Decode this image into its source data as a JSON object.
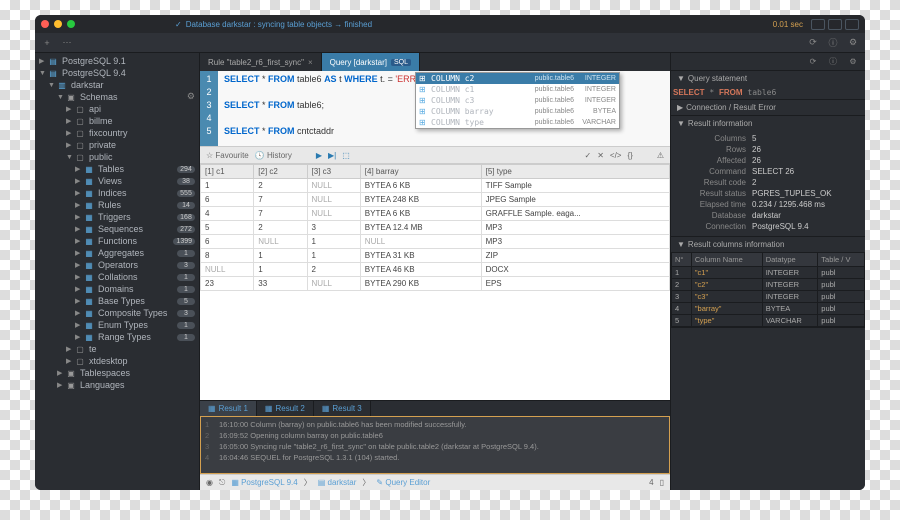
{
  "titlebar": {
    "status_text": "Database darkstar : syncing table objects → finished",
    "timing": "0.01 sec"
  },
  "sidebar": {
    "servers": [
      {
        "name": "PostgreSQL 9.1",
        "expanded": false
      },
      {
        "name": "PostgreSQL 9.4",
        "expanded": true,
        "databases": [
          {
            "name": "darkstar",
            "expanded": true,
            "schemas_label": "Schemas",
            "schemas": [
              {
                "name": "api"
              },
              {
                "name": "billme"
              },
              {
                "name": "fixcountry"
              },
              {
                "name": "private"
              },
              {
                "name": "public",
                "expanded": true,
                "items": [
                  {
                    "name": "Tables",
                    "count": 294
                  },
                  {
                    "name": "Views",
                    "count": 38
                  },
                  {
                    "name": "Indices",
                    "count": 555
                  },
                  {
                    "name": "Rules",
                    "count": 14
                  },
                  {
                    "name": "Triggers",
                    "count": 168
                  },
                  {
                    "name": "Sequences",
                    "count": 272
                  },
                  {
                    "name": "Functions",
                    "count": 1399
                  },
                  {
                    "name": "Aggregates",
                    "count": 1
                  },
                  {
                    "name": "Operators",
                    "count": 3
                  },
                  {
                    "name": "Collations",
                    "count": 1
                  },
                  {
                    "name": "Domains",
                    "count": 1
                  },
                  {
                    "name": "Base Types",
                    "count": 5
                  },
                  {
                    "name": "Composite Types",
                    "count": 3
                  },
                  {
                    "name": "Enum Types",
                    "count": 1
                  },
                  {
                    "name": "Range Types",
                    "count": 1
                  }
                ]
              },
              {
                "name": "te"
              },
              {
                "name": "xtdesktop"
              }
            ],
            "extras": [
              {
                "name": "Tablespaces"
              },
              {
                "name": "Languages"
              }
            ]
          }
        ]
      }
    ]
  },
  "tabs": [
    {
      "label": "Rule \"table2_r6_first_sync\"",
      "active": false
    },
    {
      "label": "Query [darkstar]",
      "active": true,
      "badge": "SQL"
    }
  ],
  "editor": {
    "lines": [
      {
        "n": 1,
        "sql": "SELECT * FROM table6 AS t WHERE t. = 'ERROR';"
      },
      {
        "n": 2,
        "sql": ""
      },
      {
        "n": 3,
        "sql": "SELECT * FROM table6;"
      },
      {
        "n": 4,
        "sql": ""
      },
      {
        "n": 5,
        "sql": "SELECT * FROM cntctaddr"
      }
    ]
  },
  "autocomplete": [
    {
      "kind": "COLUMN",
      "name": "c2",
      "src": "public.table6",
      "type": "INTEGER",
      "sel": true
    },
    {
      "kind": "COLUMN",
      "name": "c1",
      "src": "public.table6",
      "type": "INTEGER"
    },
    {
      "kind": "COLUMN",
      "name": "c3",
      "src": "public.table6",
      "type": "INTEGER"
    },
    {
      "kind": "COLUMN",
      "name": "barray",
      "src": "public.table6",
      "type": "BYTEA"
    },
    {
      "kind": "COLUMN",
      "name": "type",
      "src": "public.table6",
      "type": "VARCHAR"
    }
  ],
  "editor_toolbar": {
    "fav": "Favourite",
    "hist": "History"
  },
  "grid": {
    "cols": [
      "[1] c1",
      "[2] c2",
      "[3] c3",
      "[4] barray",
      "[5] type"
    ],
    "rows": [
      [
        "1",
        "2",
        "NULL",
        "BYTEA 6 KB",
        "TIFF Sample"
      ],
      [
        "6",
        "7",
        "NULL",
        "BYTEA 248 KB",
        "JPEG Sample"
      ],
      [
        "4",
        "7",
        "NULL",
        "BYTEA 6 KB",
        "GRAFFLE Sample. eaga..."
      ],
      [
        "5",
        "2",
        "3",
        "BYTEA 12.4 MB",
        "MP3"
      ],
      [
        "6",
        "NULL",
        "1",
        "NULL",
        "MP3"
      ],
      [
        "8",
        "1",
        "1",
        "BYTEA 31 KB",
        "ZIP"
      ],
      [
        "NULL",
        "1",
        "2",
        "BYTEA 46 KB",
        "DOCX"
      ],
      [
        "23",
        "33",
        "NULL",
        "BYTEA 290 KB",
        "EPS"
      ]
    ]
  },
  "result_tabs": [
    "Result 1",
    "Result 2",
    "Result 3"
  ],
  "log": [
    "16:10:00 Column (barray) on public.table6 has been modified successfully.",
    "16:09:52 Opening column barray on public.table6",
    "16:05:00 Syncing rule \"table2_r6_first_sync\" on table public.table2 (darkstar at PostgreSQL 9.4).",
    "16:04:46 SEQUEL for PostgreSQL 1.3.1 (104) started."
  ],
  "bottombar": {
    "server": "PostgreSQL 9.4",
    "db": "darkstar",
    "editor": "Query Editor",
    "count": "4"
  },
  "rpanel": {
    "query_hdr": "Query statement",
    "query": "SELECT * FROM table6",
    "conn_err": "Connection / Result Error",
    "result_info_hdr": "Result information",
    "info": [
      {
        "k": "Columns",
        "v": "5"
      },
      {
        "k": "Rows",
        "v": "26"
      },
      {
        "k": "Affected",
        "v": "26"
      },
      {
        "k": "Command",
        "v": "SELECT 26"
      },
      {
        "k": "Result code",
        "v": "2"
      },
      {
        "k": "Result status",
        "v": "PGRES_TUPLES_OK"
      },
      {
        "k": "Elapsed time",
        "v": "0.234 / 1295.468 ms"
      },
      {
        "k": "Database",
        "v": "darkstar"
      },
      {
        "k": "Connection",
        "v": "PostgreSQL 9.4"
      }
    ],
    "cols_hdr": "Result columns information",
    "cols_th": [
      "N°",
      "Column Name",
      "Datatype",
      "Table / V"
    ],
    "cols": [
      [
        "1",
        "\"c1\"",
        "INTEGER",
        "publ"
      ],
      [
        "2",
        "\"c2\"",
        "INTEGER",
        "publ"
      ],
      [
        "3",
        "\"c3\"",
        "INTEGER",
        "publ"
      ],
      [
        "4",
        "\"barray\"",
        "BYTEA",
        "publ"
      ],
      [
        "5",
        "\"type\"",
        "VARCHAR",
        "publ"
      ]
    ]
  }
}
